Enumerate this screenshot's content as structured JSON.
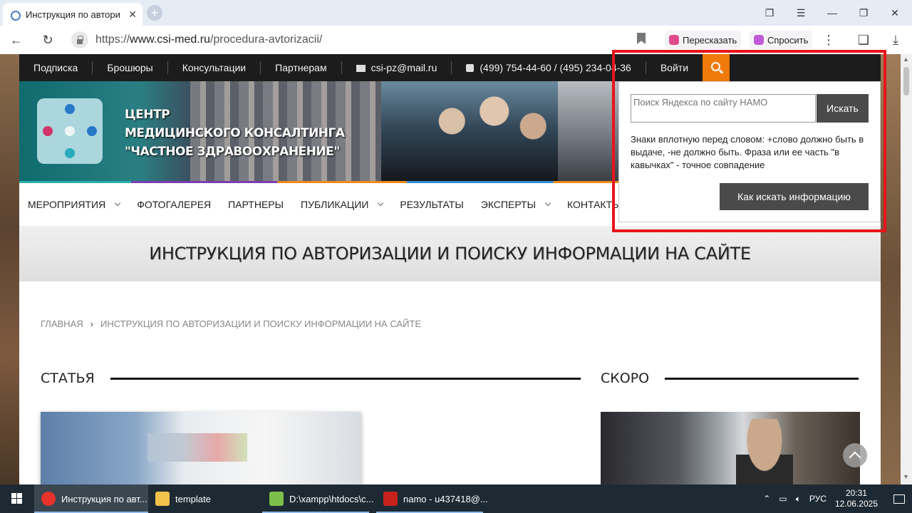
{
  "browser": {
    "tab_title": "Инструкция по автори",
    "url_prefix": "https://",
    "url_host": "www.csi-med.ru",
    "url_path": "/procedura-avtorizacii/",
    "retell_label": "Пересказать",
    "ask_label": "Спросить"
  },
  "site": {
    "topnav": [
      "Подписка",
      "Брошюры",
      "Консультации",
      "Партнерам"
    ],
    "email": "csi-pz@mail.ru",
    "phone": "(499) 754-44-60 / (495) 234-04-36",
    "login": "Войти",
    "logo_lines": [
      "ЦЕНТР",
      "МЕДИЦИНСКОГО КОНСАЛТИНГА",
      "\"ЧАСТНОЕ ЗДРАВООХРАНЕНИЕ\""
    ],
    "mainnav": [
      {
        "label": "МЕРОПРИЯТИЯ",
        "has_dropdown": true
      },
      {
        "label": "ФОТОГАЛЕРЕЯ",
        "has_dropdown": false
      },
      {
        "label": "ПАРТНЕРЫ",
        "has_dropdown": false
      },
      {
        "label": "ПУБЛИКАЦИИ",
        "has_dropdown": true
      },
      {
        "label": "РЕЗУЛЬТАТЫ",
        "has_dropdown": false
      },
      {
        "label": "ЭКСПЕРТЫ",
        "has_dropdown": true
      },
      {
        "label": "КОНТАКТЫ",
        "has_dropdown": false
      }
    ],
    "page_title": "ИНСТРУКЦИЯ ПО АВТОРИЗАЦИИ И ПОИСКУ ИНФОРМАЦИИ НА САЙТЕ",
    "breadcrumb_home": "ГЛАВНАЯ",
    "breadcrumb_sep": "›",
    "breadcrumb_current": "ИНСТРУКЦИЯ ПО АВТОРИЗАЦИИ И ПОИСКУ ИНФОРМАЦИИ НА САЙТЕ",
    "section_article": "СТАТЬЯ",
    "section_soon": "СКОРО"
  },
  "search": {
    "placeholder": "Поиск Яндекса по сайту НАМО",
    "submit_label": "Искать",
    "hint": "Знаки вплотную перед словом: +слово должно быть в выдаче, -не должно быть. Фраза или ее часть \"в кавычках\" - точное совпадение",
    "howto_label": "Как искать информацию"
  },
  "taskbar": {
    "items": [
      {
        "label": "Инструкция по авт...",
        "icon": "yandex-browser-icon",
        "color": "#e8322a",
        "active": true
      },
      {
        "label": "template",
        "icon": "folder-icon",
        "color": "#f2c24a",
        "active": false
      },
      {
        "label": "D:\\xampp\\htdocs\\c...",
        "icon": "notepad-icon",
        "color": "#7bbf4a",
        "active": false
      },
      {
        "label": "namo - u437418@...",
        "icon": "filezilla-icon",
        "color": "#c8221e",
        "active": false
      }
    ],
    "lang": "РУС",
    "time": "20:31",
    "date": "12.06.2025"
  },
  "colors": {
    "accent_orange": "#f07a0a",
    "highlight_red": "#e8141a",
    "topnav_bg": "#1c1c1c"
  }
}
